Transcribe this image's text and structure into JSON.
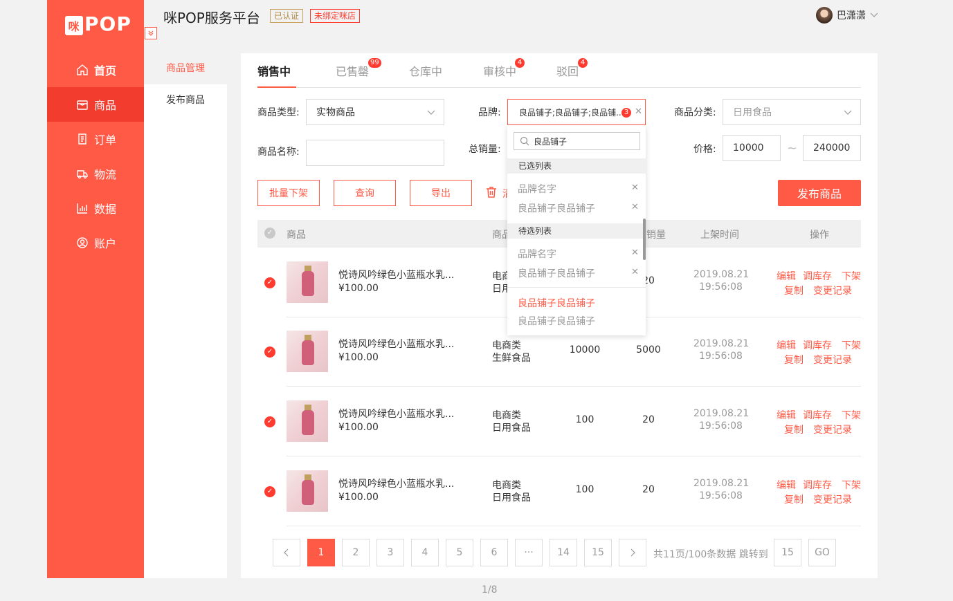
{
  "app": {
    "logo_prefix": "咪",
    "logo_text": "POP",
    "title": "咪POP服务平台",
    "badge_verified": "已认证",
    "badge_unbound": "未绑定咪店",
    "user_name": "巴潇潇",
    "collapse_icon": "double-chevron-down-icon"
  },
  "nav": [
    {
      "label": "首页",
      "icon": "home-icon"
    },
    {
      "label": "商品",
      "icon": "bag-icon"
    },
    {
      "label": "订单",
      "icon": "document-icon"
    },
    {
      "label": "物流",
      "icon": "truck-icon"
    },
    {
      "label": "数据",
      "icon": "chart-icon"
    },
    {
      "label": "账户",
      "icon": "user-icon"
    }
  ],
  "subnav": [
    {
      "label": "商品管理"
    },
    {
      "label": "发布商品"
    }
  ],
  "tabs": [
    {
      "label": "销售中",
      "count": ""
    },
    {
      "label": "已售罄",
      "count": "99"
    },
    {
      "label": "仓库中",
      "count": ""
    },
    {
      "label": "审核中",
      "count": "4"
    },
    {
      "label": "驳回",
      "count": "4"
    }
  ],
  "filters": {
    "type_label": "商品类型:",
    "type_value": "实物商品",
    "brand_label": "品牌:",
    "brand_value": "良品铺子;良品铺子;良品铺...",
    "brand_count": "3",
    "category_label": "商品分类:",
    "category_value": "日用食品",
    "name_label": "商品名称:",
    "name_value": "",
    "sales_label": "总销量:",
    "price_label": "价格:",
    "price_min": "10000",
    "price_max": "240000",
    "tilde": "~"
  },
  "actions": {
    "batch_off": "批量下架",
    "query": "查询",
    "export": "导出",
    "clear": "清",
    "publish": "发布商品"
  },
  "dropdown": {
    "search_value": "良品铺子",
    "selected_title": "已选列表",
    "selected": [
      "品牌名字",
      "良品铺子良品铺子"
    ],
    "pending_title": "待选列表",
    "pending": [
      "品牌名字",
      "良品铺子良品铺子"
    ],
    "results": [
      {
        "label": "良品铺子良品铺子",
        "highlight": true
      },
      {
        "label": "良品铺子良品铺子",
        "highlight": false
      }
    ]
  },
  "table": {
    "headers": {
      "product": "商品",
      "category": "商品",
      "sales": "销量",
      "time": "上架时间",
      "ops": "操作"
    },
    "rows": [
      {
        "name": "悦诗风吟绿色小蓝瓶水乳...",
        "price": "¥100.00",
        "cat1": "电商类",
        "cat2": "日用食品",
        "stock": "",
        "sales": "20",
        "date": "2019.08.21",
        "time": "19:56:08"
      },
      {
        "name": "悦诗风吟绿色小蓝瓶水乳...",
        "price": "¥100.00",
        "cat1": "电商类",
        "cat2": "生鲜食品",
        "stock": "10000",
        "sales": "5000",
        "date": "2019.08.21",
        "time": "19:56:08"
      },
      {
        "name": "悦诗风吟绿色小蓝瓶水乳...",
        "price": "¥100.00",
        "cat1": "电商类",
        "cat2": "日用食品",
        "stock": "100",
        "sales": "20",
        "date": "2019.08.21",
        "time": "19:56:08"
      },
      {
        "name": "悦诗风吟绿色小蓝瓶水乳...",
        "price": "¥100.00",
        "cat1": "电商类",
        "cat2": "日用食品",
        "stock": "100",
        "sales": "20",
        "date": "2019.08.21",
        "time": "19:56:08"
      }
    ],
    "ops": {
      "edit": "编辑",
      "stock": "调库存",
      "off": "下架",
      "copy": "复制",
      "log": "变更记录"
    }
  },
  "pagination": {
    "prev": "‹",
    "next": "›",
    "pages": [
      "1",
      "2",
      "3",
      "4",
      "5",
      "6",
      "···",
      "14",
      "15"
    ],
    "info": "共11页/100条数据 跳转到",
    "jump_value": "15",
    "go": "GO"
  },
  "footer": {
    "page_indicator": "1/8"
  },
  "colors": {
    "accent": "#ff5a46",
    "accent_dark": "#f23c2d"
  }
}
